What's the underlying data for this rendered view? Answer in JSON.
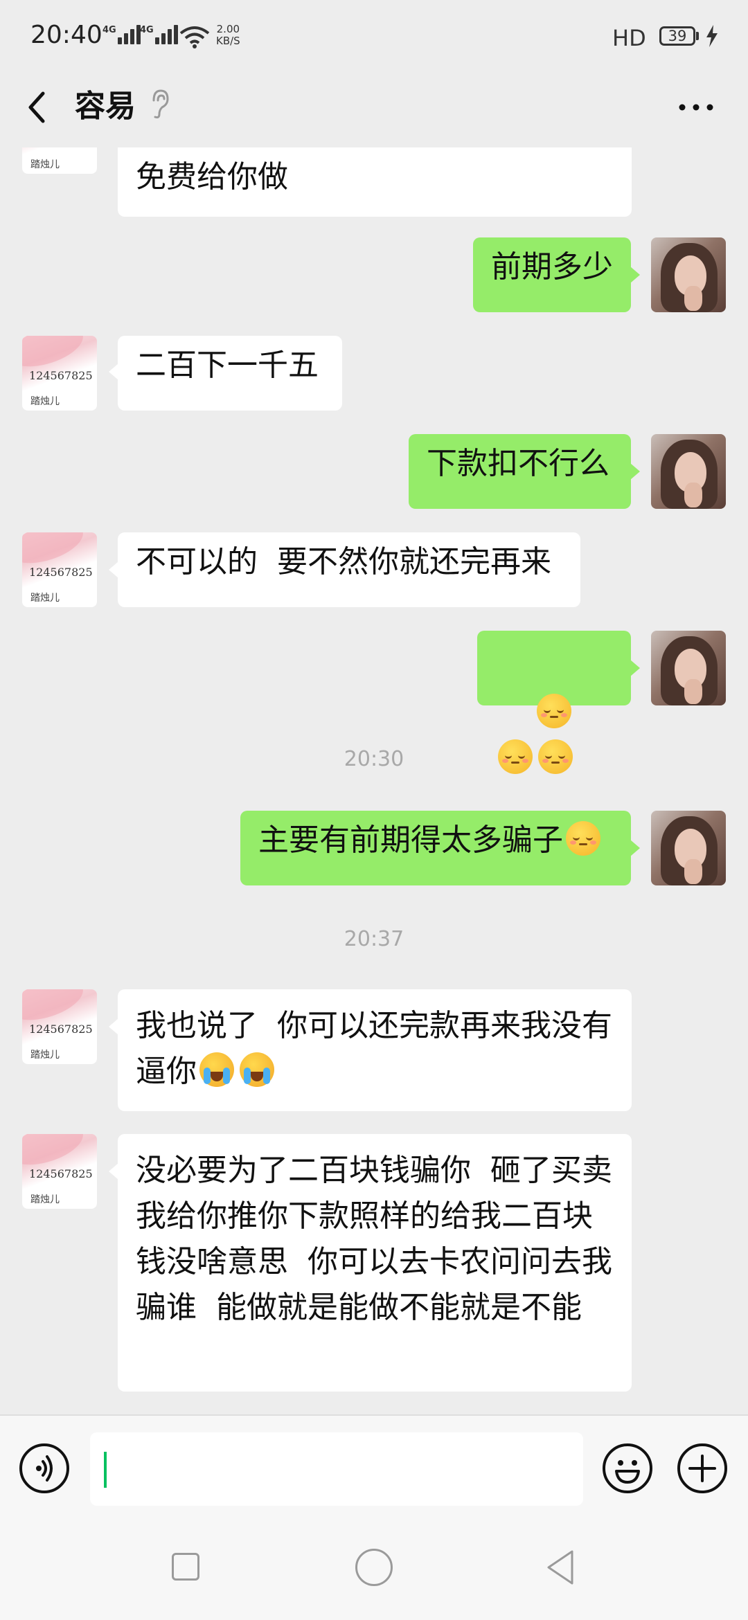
{
  "status_bar": {
    "time": "20:40",
    "signal1_label": "4G",
    "signal2_label": "4G",
    "speed_value": "2.00",
    "speed_unit": "KB/S",
    "hd_label": "HD",
    "battery": "39"
  },
  "header": {
    "title": "容易"
  },
  "avatar_in": {
    "number": "124567825",
    "name": "踏烛儿"
  },
  "messages": [
    {
      "side": "in",
      "text": "免费给你做"
    },
    {
      "side": "out",
      "text": "前期多少"
    },
    {
      "side": "in",
      "text": "二百下一千五"
    },
    {
      "side": "out",
      "text": "下款扣不行么"
    },
    {
      "side": "in",
      "text": "不可以的  要不然你就还完再来"
    },
    {
      "side": "out",
      "text": "",
      "emoji": "pleading-face x3"
    },
    {
      "side": "time",
      "text": "20:30"
    },
    {
      "side": "out",
      "text": "主要有前期得太多骗子"
    },
    {
      "side": "time",
      "text": "20:37"
    },
    {
      "side": "in",
      "text": "我也说了  你可以还完款再来我没有逼你"
    },
    {
      "side": "in",
      "text": "没必要为了二百块钱骗你  砸了买卖   我给你推你下款照样的给我二百块钱没啥意思  你可以去卡农问问去我骗谁  能做就是能做不能就是不能"
    }
  ],
  "colors": {
    "background": "#ededed",
    "bubble_out": "#95ec69",
    "bubble_in": "#ffffff",
    "caret": "#07c160",
    "timestamp": "#a8a8a8"
  }
}
